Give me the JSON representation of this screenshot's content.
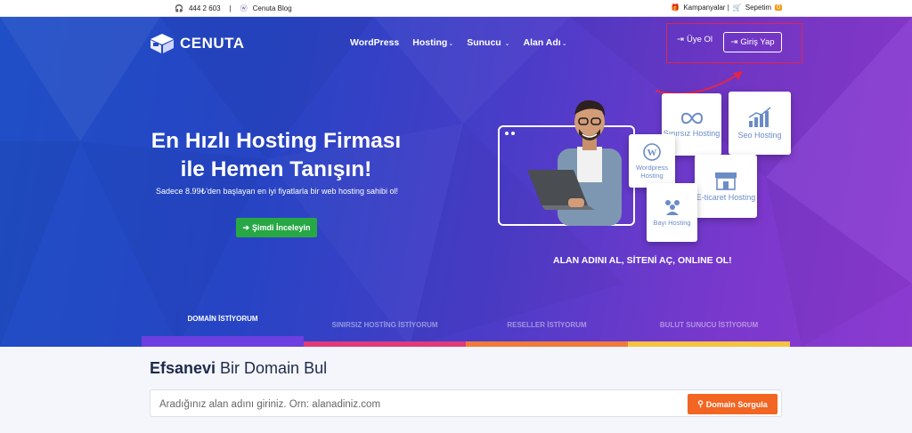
{
  "topbar": {
    "phone": "444 2 603",
    "separator": "|",
    "blog": "Cenuta Blog",
    "campaigns": "Kampanyalar |",
    "cart": "Sepetim",
    "cart_count": "0"
  },
  "header": {
    "logo_text": "CENUTA",
    "nav": [
      {
        "label": "WordPress"
      },
      {
        "label": "Hosting"
      },
      {
        "label": "Sunucu"
      },
      {
        "label": "Alan Adı"
      }
    ],
    "register_label": "Üye Ol",
    "login_label": "Giriş Yap"
  },
  "hero": {
    "headline_line1": "En Hızlı Hosting Firması",
    "headline_line2": "ile Hemen Tanışın!",
    "subline": "Sadece 8.99₺'den başlayan en iyi fiyatlarla bir web hosting sahibi ol!",
    "cta_label": "Şimdi İnceleyin",
    "slogan": "ALAN ADINI AL, SİTENİ AÇ, ONLINE OL!",
    "cards": {
      "sinirsiz": "Sınırsız Hosting",
      "seo": "Seo Hosting",
      "wordpress": "Wordpress Hosting",
      "eticaret": "E-ticaret Hosting",
      "bayi": "Bayi Hosting"
    }
  },
  "tabs": [
    {
      "label": "DOMAİN İSTİYORUM",
      "color": "#6b3fe0",
      "active": true
    },
    {
      "label": "SINIRSIZ HOSTİNG İSTİYORUM",
      "color": "#e03a7a"
    },
    {
      "label": "RESELLER İSTİYORUM",
      "color": "#f07a3c"
    },
    {
      "label": "BULUT SUNUCU İSTİYORUM",
      "color": "#f5c242"
    }
  ],
  "domain": {
    "title_bold": "Efsanevi",
    "title_rest": " Bir Domain Bul",
    "placeholder": "Aradığınız alan adını giriniz. Örn: alanadiniz.com",
    "search_label": "Domain Sorgula"
  },
  "colors": {
    "accent_green": "#28a745",
    "accent_orange": "#f26522",
    "highlight_red": "#e0264b"
  }
}
